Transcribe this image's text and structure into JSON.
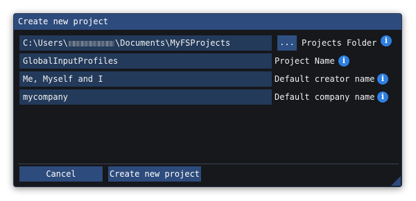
{
  "dialog": {
    "title": "Create new project"
  },
  "fields": {
    "projects_folder": {
      "value_prefix": "C:\\Users\\",
      "value_suffix": "\\Documents\\MyFSProjects",
      "browse_label": "...",
      "label": "Projects Folder"
    },
    "project_name": {
      "value": "GlobalInputProfiles",
      "label": "Project Name"
    },
    "creator_name": {
      "value": "Me, Myself and I",
      "label": "Default creator name"
    },
    "company_name": {
      "value": "mycompany",
      "label": "Default company name"
    }
  },
  "info_icon": "i",
  "footer": {
    "cancel_label": "Cancel",
    "create_label": "Create new project"
  },
  "colors": {
    "titlebar": "#2d4b7c",
    "field_bg": "#233a5a",
    "info_accent": "#2f7fe0",
    "dialog_bg": "#16181c"
  }
}
